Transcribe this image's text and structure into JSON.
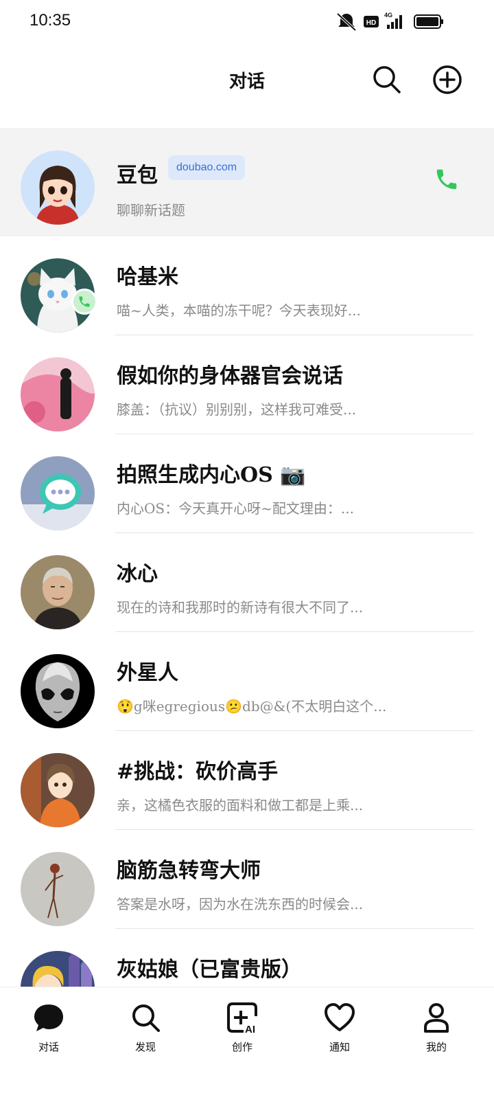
{
  "status_bar": {
    "time": "10:35",
    "network": "4G",
    "hd": "HD"
  },
  "header": {
    "title": "对话"
  },
  "conversations": [
    {
      "title": "豆包",
      "badge": "doubao.com",
      "subtitle": "聊聊新话题",
      "avatar_icon": "doubao-avatar-icon"
    },
    {
      "title": "哈基米",
      "subtitle": "喵~人类，本喵的冻干呢？今天表现好...",
      "avatar_icon": "white-cat-avatar-icon"
    },
    {
      "title": "假如你的身体器官会说话",
      "subtitle": "膝盖：（抗议）别别别，这样我可难受...",
      "avatar_icon": "pink-figure-avatar-icon"
    },
    {
      "title": "拍照生成内心OS 📷",
      "subtitle": "内心OS：今天真开心呀~配文理由：...",
      "avatar_icon": "chat-bubble-avatar-icon"
    },
    {
      "title": "冰心",
      "subtitle": "现在的诗和我那时的新诗有很大不同了...",
      "avatar_icon": "elderly-woman-avatar-icon"
    },
    {
      "title": "外星人",
      "subtitle": "😲g咪egregious😕db@&(不太明白这个...",
      "avatar_icon": "alien-avatar-icon"
    },
    {
      "title": "#挑战：砍价高手",
      "subtitle": "亲，这橘色衣服的面料和做工都是上乘...",
      "avatar_icon": "anime-girl-avatar-icon"
    },
    {
      "title": "脑筋急转弯大师",
      "subtitle": "答案是水呀，因为水在洗东西的时候会...",
      "avatar_icon": "stick-figure-avatar-icon"
    },
    {
      "title": "灰姑娘（已富贵版）",
      "subtitle": "",
      "avatar_icon": "cinderella-avatar-icon"
    }
  ],
  "tabs": [
    {
      "label": "对话",
      "icon": "chat-bubble-icon",
      "active": true
    },
    {
      "label": "发现",
      "icon": "search-icon"
    },
    {
      "label": "创作",
      "icon": "ai-create-icon"
    },
    {
      "label": "通知",
      "icon": "heart-icon"
    },
    {
      "label": "我的",
      "icon": "person-icon"
    }
  ],
  "colors": {
    "accent_green": "#34c759",
    "badge_bg": "#dde9fb",
    "badge_text": "#3570d4",
    "subtitle": "#8a8a8a"
  }
}
